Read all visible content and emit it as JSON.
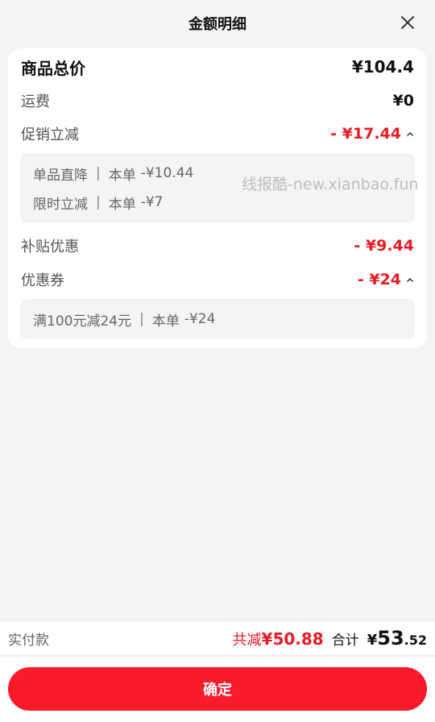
{
  "header": {
    "title": "金额明细"
  },
  "rows": {
    "total": {
      "label": "商品总价",
      "value": "¥104.4"
    },
    "shipping": {
      "label": "运费",
      "value": "¥0"
    },
    "promo": {
      "label": "促销立减",
      "value": "- ¥17.44"
    },
    "promo_details": [
      {
        "name": "单品直降",
        "scope": "本单",
        "amount": "-¥10.44"
      },
      {
        "name": "限时立减",
        "scope": "本单",
        "amount": "-¥7"
      }
    ],
    "subsidy": {
      "label": "补贴优惠",
      "value": "- ¥9.44"
    },
    "coupon": {
      "label": "优惠券",
      "value": "- ¥24"
    },
    "coupon_details": [
      {
        "name": "满100元减24元",
        "scope": "本单",
        "amount": "-¥24"
      }
    ]
  },
  "watermark": "线报酷-new.xianbao.fun",
  "footer": {
    "paid_label": "实付款",
    "discount_prefix": "共减",
    "discount_amount": "¥50.88",
    "sum_label": "合计",
    "sum_currency": "¥",
    "sum_integer": "53",
    "sum_decimal": ".52"
  },
  "confirm_label": "确定",
  "colors": {
    "accent_red": "#ea1b25",
    "button_red": "#fb1a2a",
    "background": "#f4f4f6"
  },
  "icons": {
    "close": "close-icon",
    "caret": "chevron-up-icon"
  }
}
